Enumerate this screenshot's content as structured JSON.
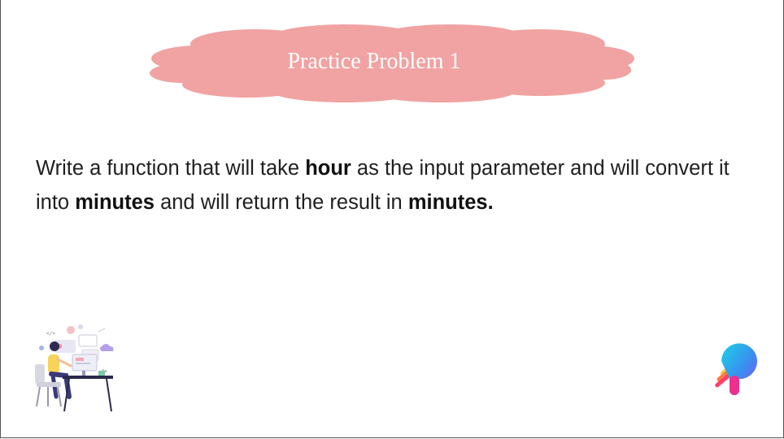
{
  "title": "Practice Problem 1",
  "problem": {
    "part1": "Write a function that will take ",
    "bold1": "hour",
    "part2": " as the input parameter and will convert it into ",
    "bold2": "minutes",
    "part3": " and will return the result in ",
    "bold3": "minutes."
  },
  "illustration": {
    "icon": "person-at-desk-illustration",
    "code_tag": "</>",
    "font_tag": "Aa"
  },
  "logo": {
    "icon": "brand-logo-icon"
  },
  "colors": {
    "cloud": "#f0a3a2",
    "title_text": "#ffffff",
    "body_text": "#1f1f1f"
  }
}
